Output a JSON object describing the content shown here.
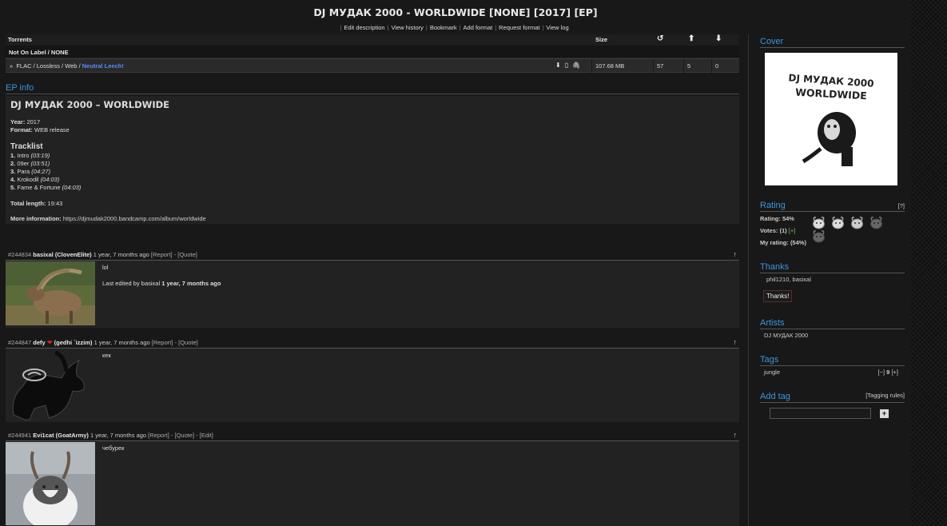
{
  "page": {
    "title": "DJ МУДАК 2000 - WORLDWIDE [NONE] [2017] [EP]",
    "actions": [
      "Edit description",
      "View history",
      "Bookmark",
      "Add format",
      "Request format",
      "View log"
    ]
  },
  "torrents": {
    "header": {
      "torrents": "Torrents",
      "size": "Size"
    },
    "group": "Not On Label / NONE",
    "row": {
      "bullet": "»",
      "format": "FLAC / Lossless / Web / ",
      "leech": "Neutral Leech!",
      "size": "107.68 MB",
      "snatches": "57",
      "seeders": "5",
      "leechers": "0"
    }
  },
  "ep_info": {
    "section_title": "EP info",
    "heading": "DJ МУДАК 2000 – WORLDWIDE",
    "year_label": "Year:",
    "year": "2017",
    "format_label": "Format:",
    "format": "WEB release",
    "tracklist_title": "Tracklist",
    "tracks": [
      {
        "num": "1.",
        "name": "Intro",
        "time": "(03:19)"
      },
      {
        "num": "2.",
        "name": "09er",
        "time": "(03:51)"
      },
      {
        "num": "3.",
        "name": "Para",
        "time": "(04:27)"
      },
      {
        "num": "4.",
        "name": "Krokodil",
        "time": "(04:03)"
      },
      {
        "num": "5.",
        "name": "Fame & Fortune",
        "time": "(04:03)"
      }
    ],
    "total_label": "Total length:",
    "total": "19:43",
    "more_label": "More information:",
    "more_url": "https://djmudak2000.bandcamp.com/album/worldwide"
  },
  "comments": [
    {
      "id": "#244834",
      "user": "basixal",
      "class": "(ClovenElite)",
      "time": "1 year, 7 months ago",
      "links": "[Report] - [Quote]",
      "text": "lol",
      "edit_prefix": "Last edited by",
      "edit_user": "basixal",
      "edit_time": "1 year, 7 months ago"
    },
    {
      "id": "#244847",
      "user": "defy",
      "class": "(gedhi `izzim)",
      "time": "1 year, 7 months ago",
      "links": "[Report] - [Quote]",
      "text": "кек"
    },
    {
      "id": "#244941",
      "user": "Evi1cat",
      "class": "(GoatArmy)",
      "time": "1 year, 7 months ago",
      "links": "[Report] - [Quote] - [Edit]",
      "text": "чебурек"
    }
  ],
  "sidebar": {
    "cover_title": "Cover",
    "cover_text_line1": "DJ МУДАК 2000",
    "cover_text_line2": "WORLDWIDE",
    "rating_title": "Rating",
    "rating_help": "[?]",
    "rating_label": "Rating:",
    "rating_value": "54%",
    "rating_level": 0.54,
    "votes_label": "Votes:",
    "votes_value": "(1)",
    "votes_add": "[+]",
    "my_rating_label": "My rating:",
    "my_rating_value": "(54%)",
    "thanks_title": "Thanks",
    "thanks_users": "phil1210, basixal",
    "thanks_button": "Thanks!",
    "artists_title": "Artists",
    "artist": "DJ МУДАК 2000",
    "tags_title": "Tags",
    "tag": "jungle",
    "tag_vote_down": "[−]",
    "tag_score": "9",
    "tag_vote_up": "[+]",
    "add_tag_title": "Add tag",
    "tagging_rules": "[Tagging rules]",
    "add_button": "+"
  },
  "colors": {
    "accent": "#3a96e0",
    "leech": "#5a8cff",
    "heart": "#d02020",
    "background": "#181818"
  }
}
